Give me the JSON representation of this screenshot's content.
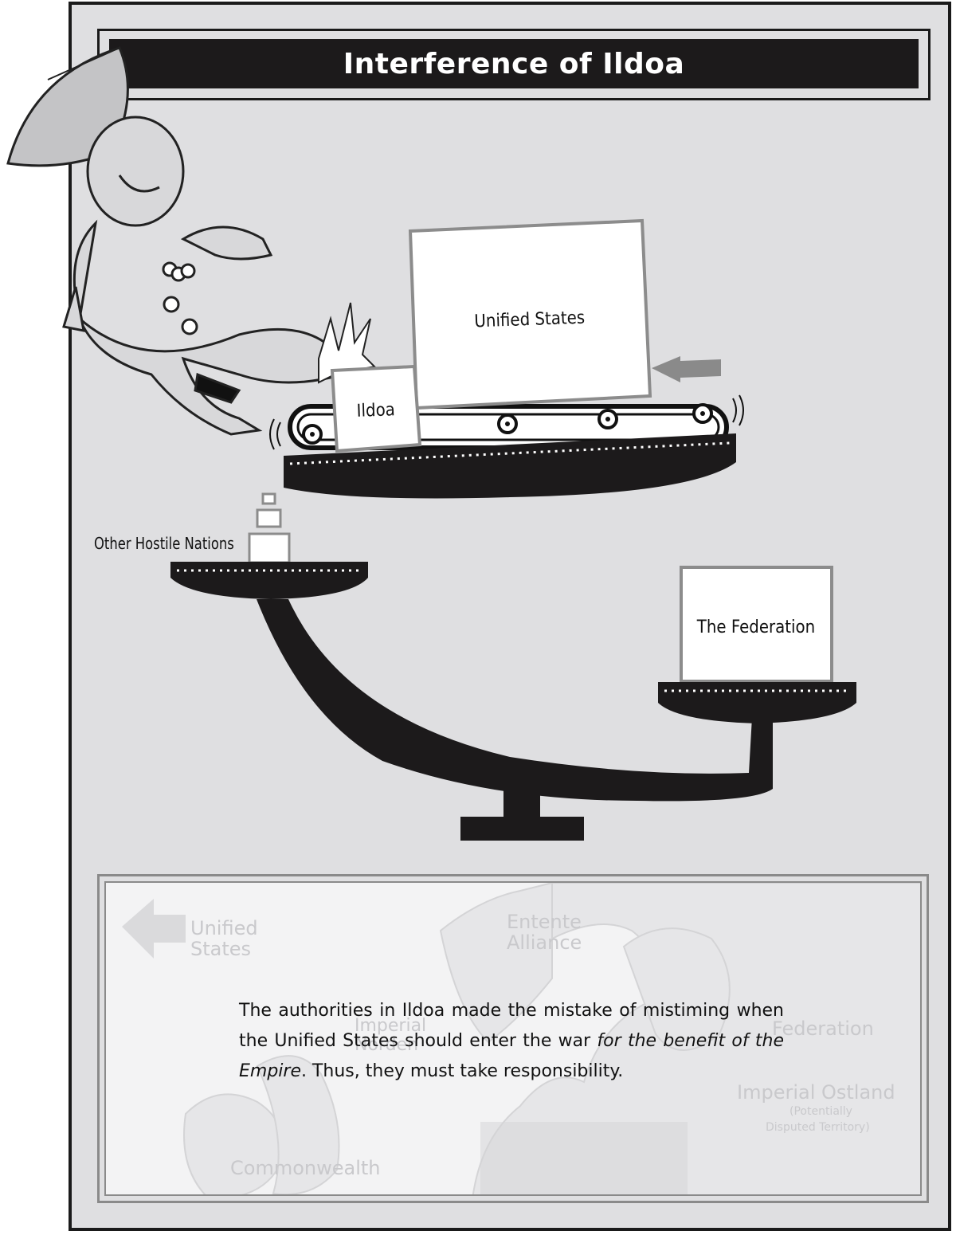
{
  "title": "Interference of Ildoa",
  "boxes": {
    "ildoa": "Ildoa",
    "unified_states": "Unified States",
    "federation": "The Federation"
  },
  "side_label": "Other Hostile Nations",
  "map": {
    "unified_states_line1": "Unified",
    "unified_states_line2": "States",
    "entente_line1": "Entente",
    "entente_line2": "Alliance",
    "imperial_norden_line1": "Imperial",
    "imperial_norden_line2": "Norden",
    "federation": "Federation",
    "imperial_ostland": "Imperial Ostland",
    "potentially": "(Potentially",
    "disputed": "Disputed Territory)",
    "commonwealth": "Commonwealth"
  },
  "caption": {
    "part1": "The authorities in Ildoa made the mistake of mistiming when the Unified States should enter the war ",
    "emphasis": "for the benefit of the Empire",
    "part2": ". Thus, they must take responsibility."
  }
}
